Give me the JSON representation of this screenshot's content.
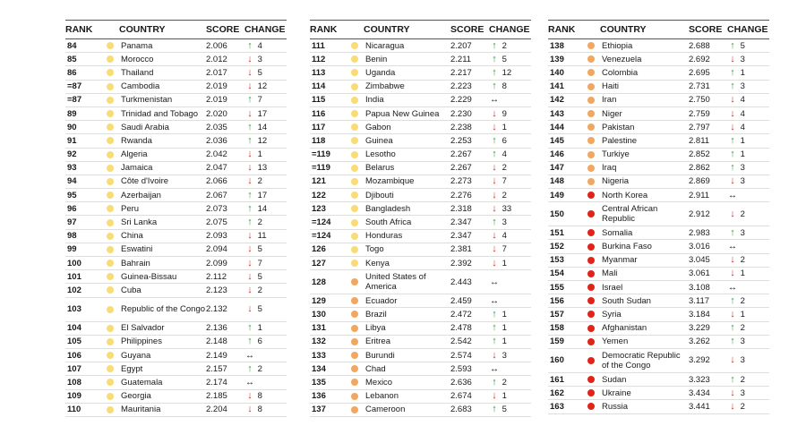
{
  "headers": {
    "rank": "RANK",
    "country": "COUNTRY",
    "score": "SCORE",
    "change": "CHANGE"
  },
  "colors": {
    "light": "#f8dc75",
    "medium": "#f2a760",
    "heavy": "#e2231a",
    "up": "#3a9a44",
    "down": "#d22b2b"
  },
  "panels": [
    [
      {
        "rank": "84",
        "country": "Panama",
        "score": "2.006",
        "dir": "up",
        "change": "4",
        "level": "light"
      },
      {
        "rank": "85",
        "country": "Morocco",
        "score": "2.012",
        "dir": "down",
        "change": "3",
        "level": "light"
      },
      {
        "rank": "86",
        "country": "Thailand",
        "score": "2.017",
        "dir": "down",
        "change": "5",
        "level": "light"
      },
      {
        "rank": "=87",
        "country": "Cambodia",
        "score": "2.019",
        "dir": "down",
        "change": "12",
        "level": "light"
      },
      {
        "rank": "=87",
        "country": "Turkmenistan",
        "score": "2.019",
        "dir": "up",
        "change": "7",
        "level": "light"
      },
      {
        "rank": "89",
        "country": "Trinidad and Tobago",
        "score": "2.020",
        "dir": "down",
        "change": "17",
        "level": "light"
      },
      {
        "rank": "90",
        "country": "Saudi Arabia",
        "score": "2.035",
        "dir": "up",
        "change": "14",
        "level": "light"
      },
      {
        "rank": "91",
        "country": "Rwanda",
        "score": "2.036",
        "dir": "up",
        "change": "12",
        "level": "light"
      },
      {
        "rank": "92",
        "country": "Algeria",
        "score": "2.042",
        "dir": "down",
        "change": "1",
        "level": "light"
      },
      {
        "rank": "93",
        "country": "Jamaica",
        "score": "2.047",
        "dir": "down",
        "change": "13",
        "level": "light"
      },
      {
        "rank": "94",
        "country": "Côte d'Ivoire",
        "score": "2.066",
        "dir": "down",
        "change": "2",
        "level": "light"
      },
      {
        "rank": "95",
        "country": "Azerbaijan",
        "score": "2.067",
        "dir": "up",
        "change": "17",
        "level": "light"
      },
      {
        "rank": "96",
        "country": "Peru",
        "score": "2.073",
        "dir": "up",
        "change": "14",
        "level": "light"
      },
      {
        "rank": "97",
        "country": "Sri Lanka",
        "score": "2.075",
        "dir": "up",
        "change": "2",
        "level": "light"
      },
      {
        "rank": "98",
        "country": "China",
        "score": "2.093",
        "dir": "down",
        "change": "11",
        "level": "light"
      },
      {
        "rank": "99",
        "country": "Eswatini",
        "score": "2.094",
        "dir": "down",
        "change": "5",
        "level": "light"
      },
      {
        "rank": "100",
        "country": "Bahrain",
        "score": "2.099",
        "dir": "down",
        "change": "7",
        "level": "light"
      },
      {
        "rank": "101",
        "country": "Guinea-Bissau",
        "score": "2.112",
        "dir": "down",
        "change": "5",
        "level": "light"
      },
      {
        "rank": "102",
        "country": "Cuba",
        "score": "2.123",
        "dir": "down",
        "change": "2",
        "level": "light"
      },
      {
        "rank": "103",
        "country": "Republic of the Congo",
        "score": "2.132",
        "dir": "down",
        "change": "5",
        "level": "light",
        "tall": true
      },
      {
        "rank": "104",
        "country": "El Salvador",
        "score": "2.136",
        "dir": "up",
        "change": "1",
        "level": "light"
      },
      {
        "rank": "105",
        "country": "Philippines",
        "score": "2.148",
        "dir": "up",
        "change": "6",
        "level": "light"
      },
      {
        "rank": "106",
        "country": "Guyana",
        "score": "2.149",
        "dir": "flat",
        "change": "",
        "level": "light"
      },
      {
        "rank": "107",
        "country": "Egypt",
        "score": "2.157",
        "dir": "up",
        "change": "2",
        "level": "light"
      },
      {
        "rank": "108",
        "country": "Guatemala",
        "score": "2.174",
        "dir": "flat",
        "change": "",
        "level": "light"
      },
      {
        "rank": "109",
        "country": "Georgia",
        "score": "2.185",
        "dir": "down",
        "change": "8",
        "level": "light"
      },
      {
        "rank": "110",
        "country": "Mauritania",
        "score": "2.204",
        "dir": "down",
        "change": "8",
        "level": "light"
      }
    ],
    [
      {
        "rank": "111",
        "country": "Nicaragua",
        "score": "2.207",
        "dir": "up",
        "change": "2",
        "level": "light"
      },
      {
        "rank": "112",
        "country": "Benin",
        "score": "2.211",
        "dir": "up",
        "change": "5",
        "level": "light"
      },
      {
        "rank": "113",
        "country": "Uganda",
        "score": "2.217",
        "dir": "up",
        "change": "12",
        "level": "light"
      },
      {
        "rank": "114",
        "country": "Zimbabwe",
        "score": "2.223",
        "dir": "up",
        "change": "8",
        "level": "light"
      },
      {
        "rank": "115",
        "country": "India",
        "score": "2.229",
        "dir": "flat",
        "change": "",
        "level": "light"
      },
      {
        "rank": "116",
        "country": "Papua New Guinea",
        "score": "2.230",
        "dir": "down",
        "change": "9",
        "level": "light"
      },
      {
        "rank": "117",
        "country": "Gabon",
        "score": "2.238",
        "dir": "down",
        "change": "1",
        "level": "light"
      },
      {
        "rank": "118",
        "country": "Guinea",
        "score": "2.253",
        "dir": "up",
        "change": "6",
        "level": "light"
      },
      {
        "rank": "=119",
        "country": "Lesotho",
        "score": "2.267",
        "dir": "up",
        "change": "4",
        "level": "light"
      },
      {
        "rank": "=119",
        "country": "Belarus",
        "score": "2.267",
        "dir": "down",
        "change": "2",
        "level": "light"
      },
      {
        "rank": "121",
        "country": "Mozambique",
        "score": "2.273",
        "dir": "down",
        "change": "7",
        "level": "light"
      },
      {
        "rank": "122",
        "country": "Djibouti",
        "score": "2.276",
        "dir": "down",
        "change": "2",
        "level": "light"
      },
      {
        "rank": "123",
        "country": "Bangladesh",
        "score": "2.318",
        "dir": "down",
        "change": "33",
        "level": "light"
      },
      {
        "rank": "=124",
        "country": "South Africa",
        "score": "2.347",
        "dir": "up",
        "change": "3",
        "level": "light"
      },
      {
        "rank": "=124",
        "country": "Honduras",
        "score": "2.347",
        "dir": "down",
        "change": "4",
        "level": "light"
      },
      {
        "rank": "126",
        "country": "Togo",
        "score": "2.381",
        "dir": "down",
        "change": "7",
        "level": "light"
      },
      {
        "rank": "127",
        "country": "Kenya",
        "score": "2.392",
        "dir": "down",
        "change": "1",
        "level": "light"
      },
      {
        "rank": "128",
        "country": "United States of America",
        "score": "2.443",
        "dir": "flat",
        "change": "",
        "level": "medium",
        "tall": true
      },
      {
        "rank": "129",
        "country": "Ecuador",
        "score": "2.459",
        "dir": "flat",
        "change": "",
        "level": "medium"
      },
      {
        "rank": "130",
        "country": "Brazil",
        "score": "2.472",
        "dir": "up",
        "change": "1",
        "level": "medium"
      },
      {
        "rank": "131",
        "country": "Libya",
        "score": "2.478",
        "dir": "up",
        "change": "1",
        "level": "medium"
      },
      {
        "rank": "132",
        "country": "Eritrea",
        "score": "2.542",
        "dir": "up",
        "change": "1",
        "level": "medium"
      },
      {
        "rank": "133",
        "country": "Burundi",
        "score": "2.574",
        "dir": "down",
        "change": "3",
        "level": "medium"
      },
      {
        "rank": "134",
        "country": "Chad",
        "score": "2.593",
        "dir": "flat",
        "change": "",
        "level": "medium"
      },
      {
        "rank": "135",
        "country": "Mexico",
        "score": "2.636",
        "dir": "up",
        "change": "2",
        "level": "medium"
      },
      {
        "rank": "136",
        "country": "Lebanon",
        "score": "2.674",
        "dir": "down",
        "change": "1",
        "level": "medium"
      },
      {
        "rank": "137",
        "country": "Cameroon",
        "score": "2.683",
        "dir": "up",
        "change": "5",
        "level": "medium"
      }
    ],
    [
      {
        "rank": "138",
        "country": "Ethiopia",
        "score": "2.688",
        "dir": "up",
        "change": "5",
        "level": "medium"
      },
      {
        "rank": "139",
        "country": "Venezuela",
        "score": "2.692",
        "dir": "down",
        "change": "3",
        "level": "medium"
      },
      {
        "rank": "140",
        "country": "Colombia",
        "score": "2.695",
        "dir": "up",
        "change": "1",
        "level": "medium"
      },
      {
        "rank": "141",
        "country": "Haiti",
        "score": "2.731",
        "dir": "up",
        "change": "3",
        "level": "medium"
      },
      {
        "rank": "142",
        "country": "Iran",
        "score": "2.750",
        "dir": "down",
        "change": "4",
        "level": "medium"
      },
      {
        "rank": "143",
        "country": "Niger",
        "score": "2.759",
        "dir": "down",
        "change": "4",
        "level": "medium"
      },
      {
        "rank": "144",
        "country": "Pakistan",
        "score": "2.797",
        "dir": "down",
        "change": "4",
        "level": "medium"
      },
      {
        "rank": "145",
        "country": "Palestine",
        "score": "2.811",
        "dir": "up",
        "change": "1",
        "level": "medium"
      },
      {
        "rank": "146",
        "country": "Turkiye",
        "score": "2.852",
        "dir": "up",
        "change": "1",
        "level": "medium"
      },
      {
        "rank": "147",
        "country": "Iraq",
        "score": "2.862",
        "dir": "up",
        "change": "3",
        "level": "medium"
      },
      {
        "rank": "148",
        "country": "Nigeria",
        "score": "2.869",
        "dir": "down",
        "change": "3",
        "level": "medium"
      },
      {
        "rank": "149",
        "country": "North Korea",
        "score": "2.911",
        "dir": "flat",
        "change": "",
        "level": "heavy"
      },
      {
        "rank": "150",
        "country": "Central African Republic",
        "score": "2.912",
        "dir": "down",
        "change": "2",
        "level": "heavy",
        "tall": true
      },
      {
        "rank": "151",
        "country": "Somalia",
        "score": "2.983",
        "dir": "up",
        "change": "3",
        "level": "heavy"
      },
      {
        "rank": "152",
        "country": "Burkina Faso",
        "score": "3.016",
        "dir": "flat",
        "change": "",
        "level": "heavy"
      },
      {
        "rank": "153",
        "country": "Myanmar",
        "score": "3.045",
        "dir": "down",
        "change": "2",
        "level": "heavy"
      },
      {
        "rank": "154",
        "country": "Mali",
        "score": "3.061",
        "dir": "down",
        "change": "1",
        "level": "heavy"
      },
      {
        "rank": "155",
        "country": "Israel",
        "score": "3.108",
        "dir": "flat",
        "change": "",
        "level": "heavy"
      },
      {
        "rank": "156",
        "country": "South Sudan",
        "score": "3.117",
        "dir": "up",
        "change": "2",
        "level": "heavy"
      },
      {
        "rank": "157",
        "country": "Syria",
        "score": "3.184",
        "dir": "down",
        "change": "1",
        "level": "heavy"
      },
      {
        "rank": "158",
        "country": "Afghanistan",
        "score": "3.229",
        "dir": "up",
        "change": "2",
        "level": "heavy"
      },
      {
        "rank": "159",
        "country": "Yemen",
        "score": "3.262",
        "dir": "up",
        "change": "3",
        "level": "heavy"
      },
      {
        "rank": "160",
        "country": "Democratic Republic of the Congo",
        "score": "3.292",
        "dir": "down",
        "change": "3",
        "level": "heavy",
        "tall": true
      },
      {
        "rank": "161",
        "country": "Sudan",
        "score": "3.323",
        "dir": "up",
        "change": "2",
        "level": "heavy"
      },
      {
        "rank": "162",
        "country": "Ukraine",
        "score": "3.434",
        "dir": "down",
        "change": "3",
        "level": "heavy"
      },
      {
        "rank": "163",
        "country": "Russia",
        "score": "3.441",
        "dir": "down",
        "change": "2",
        "level": "heavy"
      }
    ]
  ]
}
